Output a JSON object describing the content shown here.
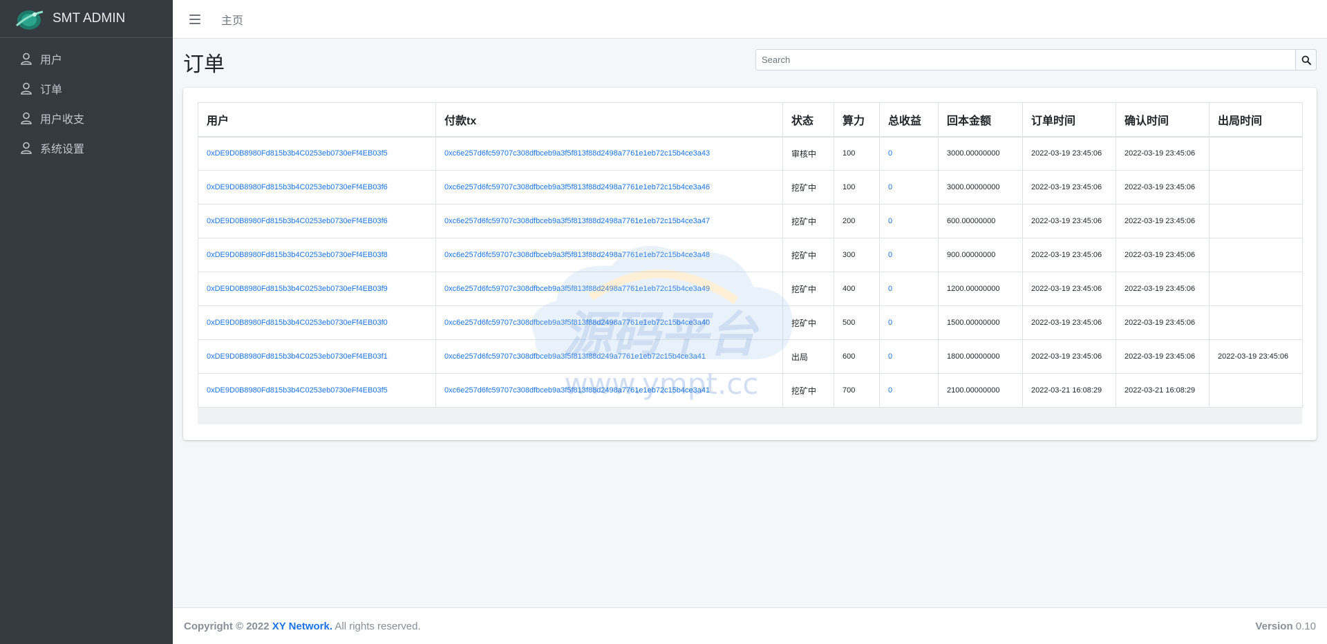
{
  "brand": {
    "name": "SMT ADMIN"
  },
  "sidebar": {
    "items": [
      {
        "label": "用户",
        "icon": "user-icon"
      },
      {
        "label": "订单",
        "icon": "user-icon"
      },
      {
        "label": "用户收支",
        "icon": "user-icon"
      },
      {
        "label": "系统设置",
        "icon": "user-icon"
      }
    ]
  },
  "topbar": {
    "home_label": "主页"
  },
  "page": {
    "title": "订单"
  },
  "search": {
    "placeholder": "Search"
  },
  "table": {
    "headers": [
      "用户",
      "付款tx",
      "状态",
      "算力",
      "总收益",
      "回本金额",
      "订单时间",
      "确认时间",
      "出局时间"
    ],
    "rows": [
      [
        "0xDE9D0B8980Fd815b3b4C0253eb0730eFf4EB03f5",
        "0xc6e257d6fc59707c308dfbceb9a3f5f813f88d2498a7761e1eb72c15b4ce3a43",
        "审核中",
        "100",
        "0",
        "3000.00000000",
        "2022-03-19 23:45:06",
        "2022-03-19 23:45:06",
        ""
      ],
      [
        "0xDE9D0B8980Fd815b3b4C0253eb0730eFf4EB03f6",
        "0xc6e257d6fc59707c308dfbceb9a3f5f813f88d2498a7761e1eb72c15b4ce3a46",
        "挖矿中",
        "100",
        "0",
        "3000.00000000",
        "2022-03-19 23:45:06",
        "2022-03-19 23:45:06",
        ""
      ],
      [
        "0xDE9D0B8980Fd815b3b4C0253eb0730eFf4EB03f6",
        "0xc6e257d6fc59707c308dfbceb9a3f5f813f88d2498a7761e1eb72c15b4ce3a47",
        "挖矿中",
        "200",
        "0",
        "600.00000000",
        "2022-03-19 23:45:06",
        "2022-03-19 23:45:06",
        ""
      ],
      [
        "0xDE9D0B8980Fd815b3b4C0253eb0730eFf4EB03f8",
        "0xc6e257d6fc59707c308dfbceb9a3f5f813f88d2498a7761e1eb72c15b4ce3a48",
        "挖矿中",
        "300",
        "0",
        "900.00000000",
        "2022-03-19 23:45:06",
        "2022-03-19 23:45:06",
        ""
      ],
      [
        "0xDE9D0B8980Fd815b3b4C0253eb0730eFf4EB03f9",
        "0xc6e257d6fc59707c308dfbceb9a3f5f813f88d2498a7761e1eb72c15b4ce3a49",
        "挖矿中",
        "400",
        "0",
        "1200.00000000",
        "2022-03-19 23:45:06",
        "2022-03-19 23:45:06",
        ""
      ],
      [
        "0xDE9D0B8980Fd815b3b4C0253eb0730eFf4EB03f0",
        "0xc6e257d6fc59707c308dfbceb9a3f5f813f88d2498a7761e1eb72c15b4ce3a40",
        "挖矿中",
        "500",
        "0",
        "1500.00000000",
        "2022-03-19 23:45:06",
        "2022-03-19 23:45:06",
        ""
      ],
      [
        "0xDE9D0B8980Fd815b3b4C0253eb0730eFf4EB03f1",
        "0xc6e257d6fc59707c308dfbceb9a3f5f813f88d249a7761e1eb72c15b4ce3a41",
        "出局",
        "600",
        "0",
        "1800.00000000",
        "2022-03-19 23:45:06",
        "2022-03-19 23:45:06",
        "2022-03-19 23:45:06"
      ],
      [
        "0xDE9D0B8980Fd815b3b4C0253eb0730eFf4EB03f5",
        "0xc6e257d6fc59707c308dfbceb9a3f5f813f88d2498a7761e1eb72c15b4ce3a41",
        "挖矿中",
        "700",
        "0",
        "2100.00000000",
        "2022-03-21 16:08:29",
        "2022-03-21 16:08:29",
        ""
      ]
    ]
  },
  "watermark": {
    "title": "源码平台",
    "url": "www.ympt.cc"
  },
  "footer": {
    "copyright_prefix": "Copyright © 2022",
    "company": "XY Network.",
    "rights": "All rights reserved.",
    "version_label": "Version",
    "version_number": "0.10"
  },
  "colors": {
    "sidebar_bg": "#343a40",
    "link": "#1a73e8",
    "page_bg": "#f4f6f9"
  }
}
